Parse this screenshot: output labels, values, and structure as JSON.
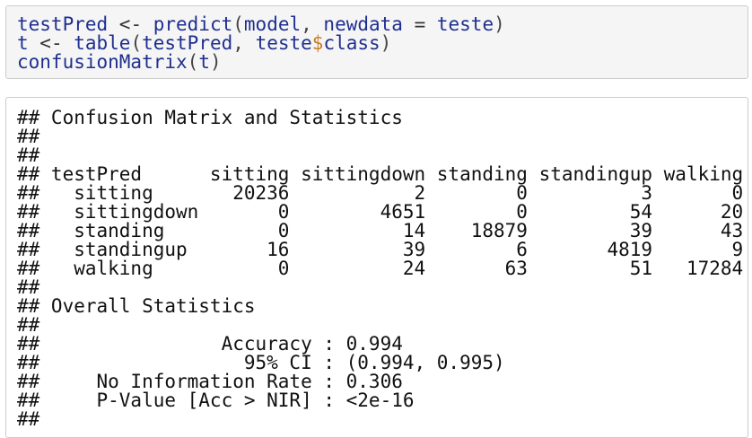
{
  "code": {
    "lines": [
      [
        {
          "t": "testPred",
          "k": "id"
        },
        {
          "t": " <- ",
          "k": "op"
        },
        {
          "t": "predict",
          "k": "id"
        },
        {
          "t": "(",
          "k": "punct"
        },
        {
          "t": "model",
          "k": "id"
        },
        {
          "t": ", ",
          "k": "punct"
        },
        {
          "t": "newdata",
          "k": "id"
        },
        {
          "t": " = ",
          "k": "op"
        },
        {
          "t": "teste",
          "k": "id"
        },
        {
          "t": ")",
          "k": "punct"
        }
      ],
      [
        {
          "t": "t",
          "k": "id"
        },
        {
          "t": " <- ",
          "k": "op"
        },
        {
          "t": "table",
          "k": "id"
        },
        {
          "t": "(",
          "k": "punct"
        },
        {
          "t": "testPred",
          "k": "id"
        },
        {
          "t": ", ",
          "k": "punct"
        },
        {
          "t": "teste",
          "k": "id"
        },
        {
          "t": "$",
          "k": "dollar"
        },
        {
          "t": "class",
          "k": "id"
        },
        {
          "t": ")",
          "k": "punct"
        }
      ],
      [
        {
          "t": "confusionMatrix",
          "k": "id"
        },
        {
          "t": "(",
          "k": "punct"
        },
        {
          "t": "t",
          "k": "id"
        },
        {
          "t": ")",
          "k": "punct"
        }
      ]
    ]
  },
  "output": {
    "lines": [
      "## Confusion Matrix and Statistics",
      "##",
      "##",
      "## testPred      sitting sittingdown standing standingup walking",
      "##   sitting       20236           2        0          3       0",
      "##   sittingdown       0        4651        0         54      20",
      "##   standing          0          14    18879         39      43",
      "##   standingup       16          39        6       4819       9",
      "##   walking           0          24       63         51   17284",
      "##",
      "## Overall Statistics",
      "##",
      "##                Accuracy : 0.994",
      "##                  95% CI : (0.994, 0.995)",
      "##     No Information Rate : 0.306",
      "##     P-Value [Acc > NIR] : <2e-16",
      "##"
    ]
  }
}
